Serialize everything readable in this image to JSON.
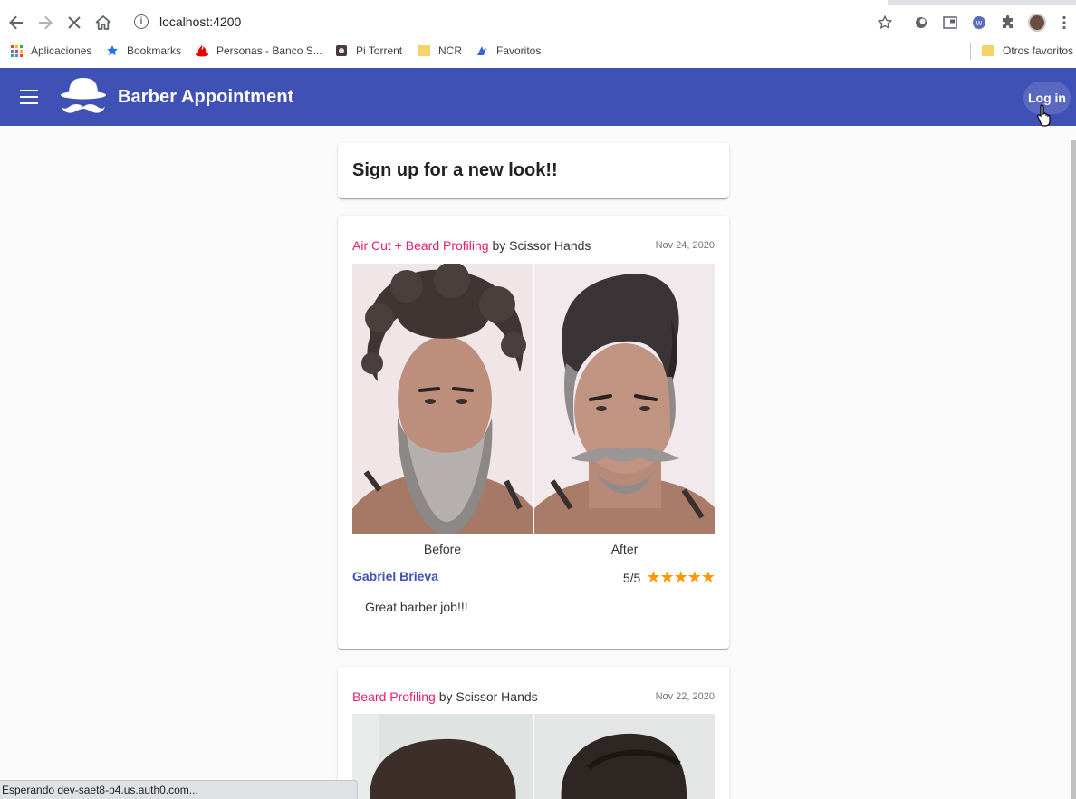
{
  "browser": {
    "url": "localhost:4200",
    "bookmarks": [
      {
        "label": "Aplicaciones",
        "icon": "apps-grid-icon"
      },
      {
        "label": "Bookmarks",
        "icon": "star-icon"
      },
      {
        "label": "Personas - Banco S...",
        "icon": "santander-icon"
      },
      {
        "label": "Pi Torrent",
        "icon": "torrent-icon"
      },
      {
        "label": "NCR",
        "icon": "folder-icon"
      },
      {
        "label": "Favoritos",
        "icon": "favoritos-icon"
      }
    ],
    "other_bookmarks": "Otros favoritos",
    "status_text": "Esperando dev-saet8-p4.us.auth0.com..."
  },
  "header": {
    "title": "Barber Appointment",
    "login_label": "Log in",
    "background": "#3f51b5"
  },
  "signup_card": {
    "title": "Sign up for a new look!!"
  },
  "posts": [
    {
      "service": "Air Cut + Beard Profiling",
      "by_text": " by Scissor Hands",
      "date": "Nov 24, 2020",
      "before_label": "Before",
      "after_label": "After",
      "author": "Gabriel Brieva",
      "rating_text": "5/5",
      "stars": "★★★★★",
      "rating": 5,
      "comment": "Great barber job!!!"
    },
    {
      "service": "Beard Profiling",
      "by_text": " by Scissor Hands",
      "date": "Nov 22, 2020"
    }
  ],
  "colors": {
    "accent": "#e91e63",
    "primary": "#3f51b5",
    "star": "#ff9800"
  }
}
